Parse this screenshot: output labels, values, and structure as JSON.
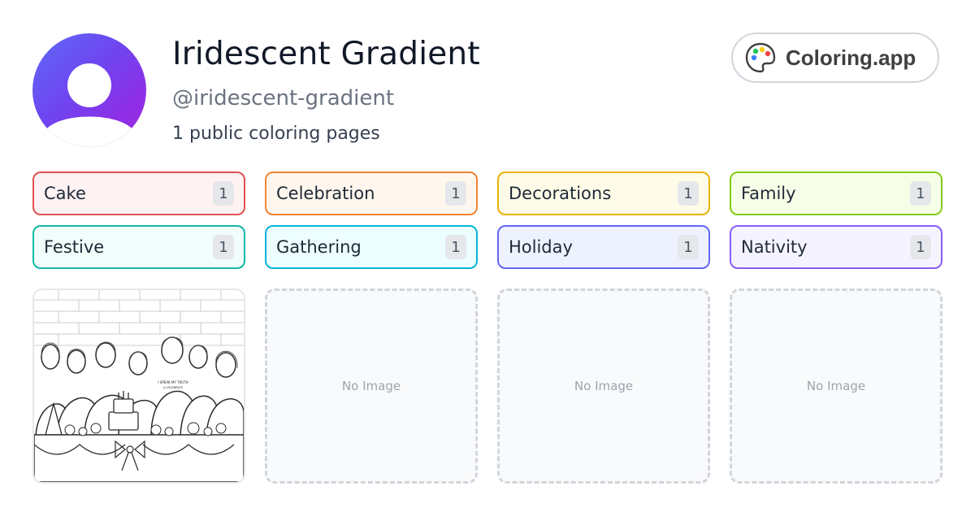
{
  "profile": {
    "name": "Iridescent Gradient",
    "handle": "@iridescent-gradient",
    "count_text": "1 public coloring pages"
  },
  "brand": {
    "label": "Coloring.app",
    "icon": "palette-icon"
  },
  "tags": [
    {
      "label": "Cake",
      "count": "1",
      "border": "#e05252",
      "bg": "#fef2f2"
    },
    {
      "label": "Celebration",
      "count": "1",
      "border": "#ef8434",
      "bg": "#fff7ed"
    },
    {
      "label": "Decorations",
      "count": "1",
      "border": "#eab308",
      "bg": "#fefce8"
    },
    {
      "label": "Family",
      "count": "1",
      "border": "#84cc16",
      "bg": "#f7fee7"
    },
    {
      "label": "Festive",
      "count": "1",
      "border": "#14b8a6",
      "bg": "#f0fdfa"
    },
    {
      "label": "Gathering",
      "count": "1",
      "border": "#06b6d4",
      "bg": "#ecfeff"
    },
    {
      "label": "Holiday",
      "count": "1",
      "border": "#6366f1",
      "bg": "#eef2ff"
    },
    {
      "label": "Nativity",
      "count": "1",
      "border": "#8b5cf6",
      "bg": "#f5f3ff"
    }
  ],
  "pages": {
    "placeholders": [
      "No Image",
      "No Image",
      "No Image"
    ],
    "artwork_shirt_text": [
      "I SPEAK MY TRUTH",
      "& CELEBRATE"
    ]
  },
  "colors": {
    "avatar_gradient": [
      "#5d6af6",
      "#9b2de0"
    ],
    "text_primary": "#111827",
    "text_secondary": "#6b7280"
  }
}
